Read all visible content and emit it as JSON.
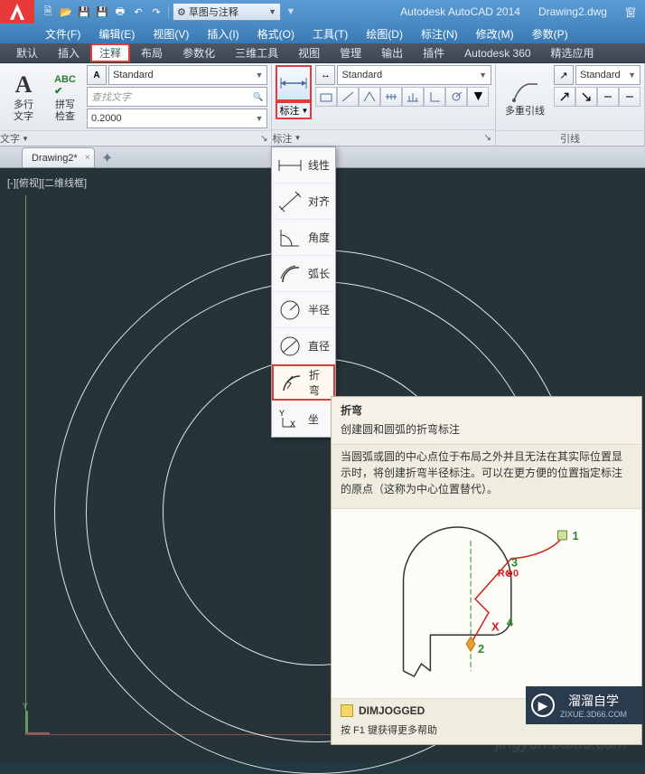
{
  "titlebar": {
    "app": "Autodesk AutoCAD 2014",
    "file": "Drawing2.dwg",
    "win": "窗",
    "workspace": "草图与注释"
  },
  "menu": [
    "文件(F)",
    "编辑(E)",
    "视图(V)",
    "插入(I)",
    "格式(O)",
    "工具(T)",
    "绘图(D)",
    "标注(N)",
    "修改(M)",
    "参数(P)"
  ],
  "rtabs": [
    "默认",
    "插入",
    "注释",
    "布局",
    "参数化",
    "三维工具",
    "视图",
    "管理",
    "输出",
    "插件",
    "Autodesk 360",
    "精选应用"
  ],
  "ribbon": {
    "text": {
      "big": "多行\n文字",
      "abc": "拼写\n检查",
      "style": "Standard",
      "find": "查找文字",
      "height": "0.2000",
      "panel": "文字"
    },
    "dim": {
      "style": "Standard",
      "btn": "标注",
      "panel": "标注"
    },
    "leader": {
      "big": "多重引线",
      "style": "Standard",
      "panel": "引线"
    }
  },
  "filetab": "Drawing2*",
  "viewport": "[-][俯视][二维线框]",
  "dimmenu": [
    "线性",
    "对齐",
    "角度",
    "弧长",
    "半径",
    "直径",
    "折弯",
    "坐"
  ],
  "tooltip": {
    "title": "折弯",
    "sub": "创建圆和圆弧的折弯标注",
    "body": "当圆弧或圆的中心点位于布局之外并且无法在其实际位置显示时，将创建折弯半径标注。可以在更方便的位置指定标注的原点（这称为中心位置替代）。",
    "labels": {
      "n1": "1",
      "n2": "2",
      "n3": "3",
      "n4": "4",
      "r": "R30",
      "x": "X"
    },
    "cmd": "DIMJOGGED",
    "hint": "按 F1 键获得更多帮助"
  },
  "brand": {
    "name": "溜溜自学",
    "url": "ZIXUE.3D66.COM"
  },
  "wm": "jingyun.baidu.com"
}
